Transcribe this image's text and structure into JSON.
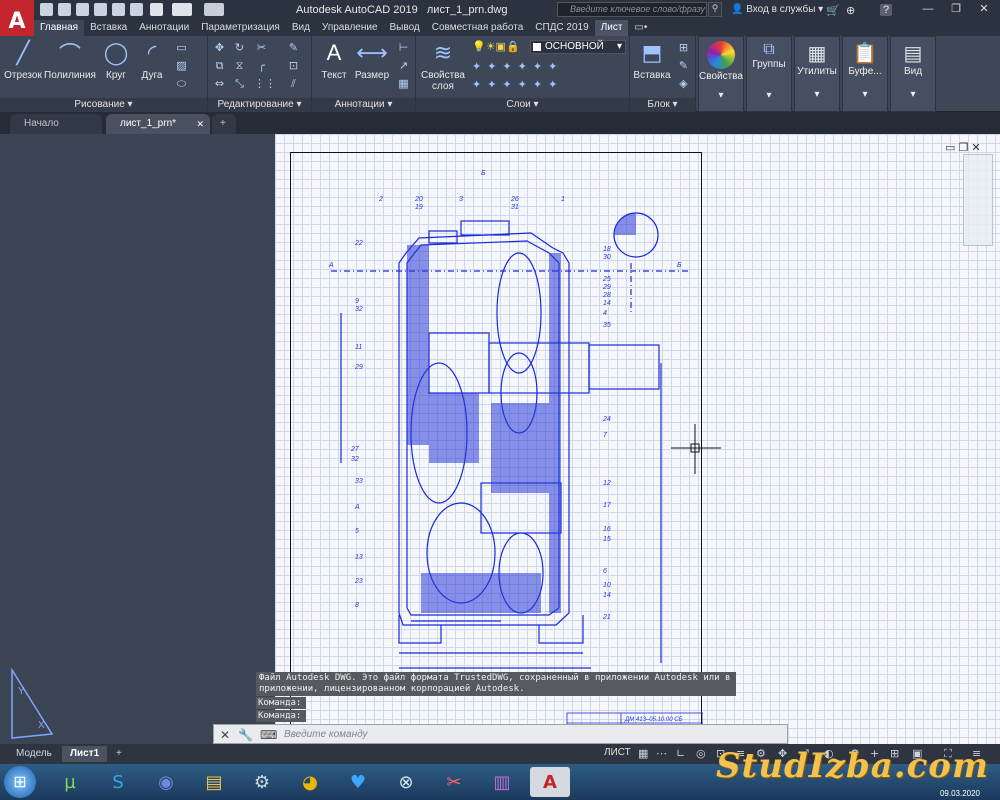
{
  "title": {
    "app": "Autodesk AutoCAD 2019",
    "file": "лист_1_prn.dwg",
    "search_placeholder": "Введите ключевое слово/фразу",
    "signin": "Вход в службы"
  },
  "ribbon_tabs": [
    "Главная",
    "Вставка",
    "Аннотации",
    "Параметризация",
    "Вид",
    "Управление",
    "Вывод",
    "Совместная работа",
    "СПДС 2019",
    "Лист"
  ],
  "ribbon": {
    "draw": {
      "title": "Рисование",
      "tools": [
        "Отрезок",
        "Полилиния",
        "Круг",
        "Дуга"
      ]
    },
    "modify": {
      "title": "Редактирование"
    },
    "annotation": {
      "title": "Аннотации",
      "tools": [
        "Текст",
        "Размер"
      ]
    },
    "layers": {
      "title": "Слои",
      "tool": "Свойства слоя",
      "current_layer": "ОСНОВНОЙ"
    },
    "block": {
      "title": "Блок",
      "tool": "Вставка"
    },
    "properties": "Свойства",
    "groups": "Группы",
    "utilities": "Утилиты",
    "clipboard": "Буфе...",
    "view": "Вид"
  },
  "doc_tabs": [
    "Начало",
    "лист_1_prn*"
  ],
  "drawing": {
    "callouts": [
      "2",
      "20",
      "19",
      "3",
      "26",
      "31",
      "1",
      "22",
      "18",
      "30",
      "25",
      "29",
      "28",
      "14",
      "4",
      "35",
      "9",
      "32",
      "11",
      "29",
      "24",
      "27",
      "32",
      "7",
      "33",
      "A",
      "5",
      "13",
      "23",
      "8",
      "12",
      "17",
      "16",
      "15",
      "6",
      "10",
      "14",
      "21"
    ],
    "section_labels": [
      "Б",
      "А",
      "Б"
    ],
    "stamp": "ДМ 413–05.10.00 СБ"
  },
  "command": {
    "history": "Файл Autodesk DWG. Это файл формата TrustedDWG, сохраненный в приложении Autodesk или в приложении, лицензированном корпорацией Autodesk.",
    "prompt1": "Команда:",
    "prompt2": "Команда:",
    "placeholder": "Введите команду"
  },
  "layout_tabs": [
    "Модель",
    "Лист1"
  ],
  "status": {
    "space": "ЛИСТ"
  },
  "watermark": "StudIzba.com",
  "clock": "09.03.2020"
}
